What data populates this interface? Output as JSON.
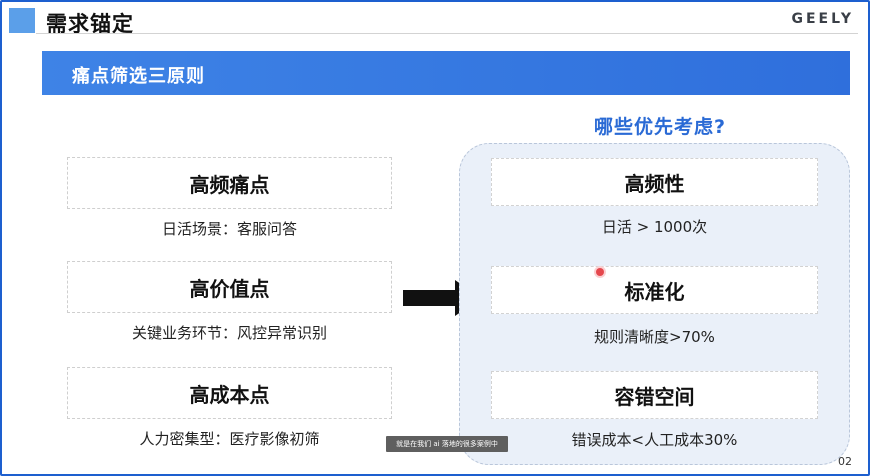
{
  "header": {
    "title": "需求锚定",
    "logo": "GEELY"
  },
  "banner": {
    "text": "痛点筛选三原则"
  },
  "left_items": [
    {
      "title": "高频痛点",
      "subtitle": "日活场景：客服问答"
    },
    {
      "title": "高价值点",
      "subtitle": "关键业务环节：风控异常识别"
    },
    {
      "title": "高成本点",
      "subtitle": "人力密集型：医疗影像初筛"
    }
  ],
  "right_panel": {
    "question": "哪些优先考虑?",
    "items": [
      {
        "title": "高频性",
        "subtitle": "日活 > 1000次"
      },
      {
        "title": "标准化",
        "subtitle": "规则清晰度>70%"
      },
      {
        "title": "容错空间",
        "subtitle": "错误成本<人工成本30%"
      }
    ]
  },
  "caption": "就是在我们 ai 落地的很多案例中",
  "page_number": "02",
  "colors": {
    "accent_blue": "#2f6fdc",
    "panel_bg": "#eaf0f9",
    "question_text": "#2a6ad5"
  }
}
